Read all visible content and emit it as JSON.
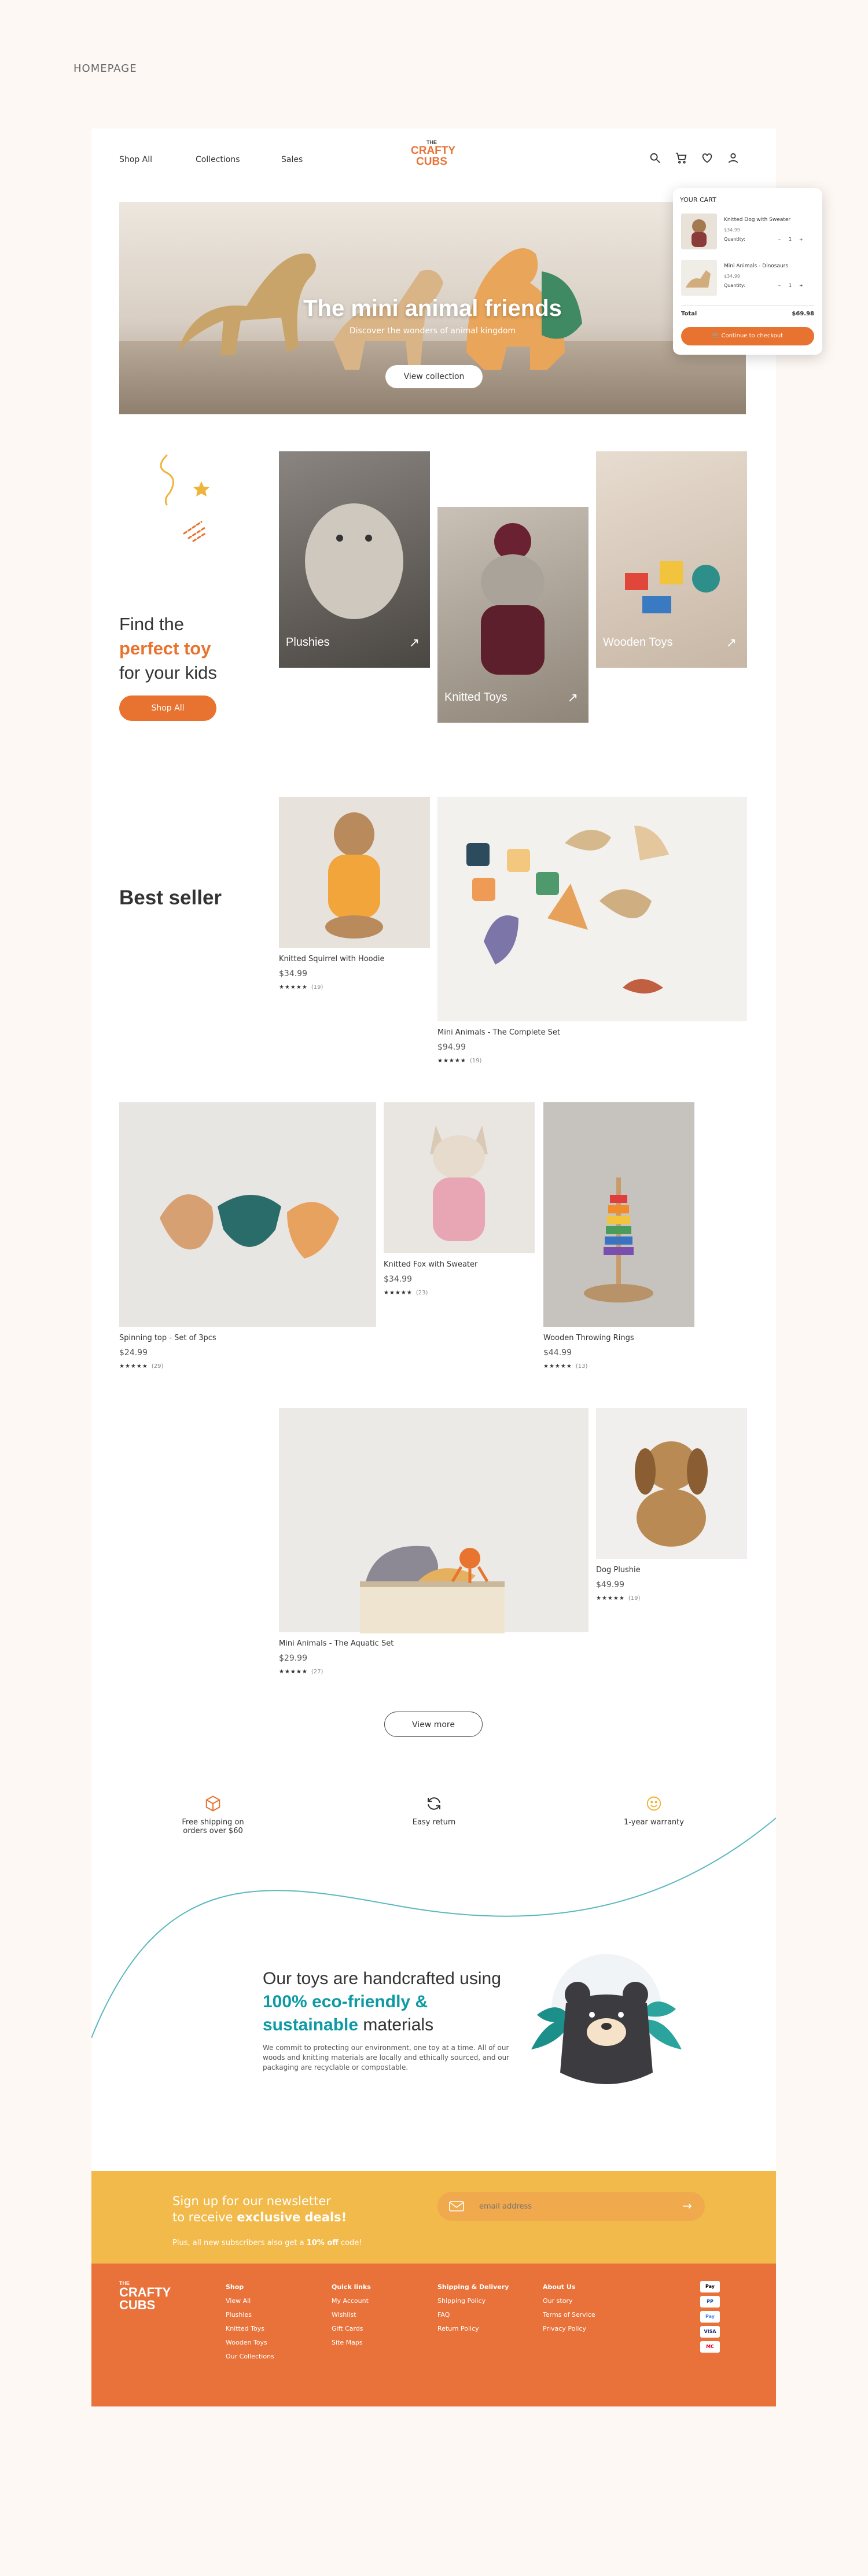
{
  "page_label": "HOMEPAGE",
  "brand": {
    "top": "THE",
    "line1": "CRAFTY",
    "line2": "CUBS"
  },
  "nav": {
    "links": [
      "Shop All",
      "Collections",
      "Sales"
    ]
  },
  "hero": {
    "title": "The mini animal friends",
    "subtitle": "Discover the wonders of animal kingdom",
    "button": "View collection"
  },
  "cart": {
    "title": "YOUR CART",
    "items": [
      {
        "name": "Knitted Dog with Sweater",
        "price": "$34.99",
        "qty_label": "Quantity:",
        "minus": "–",
        "qty": "1",
        "plus": "+"
      },
      {
        "name": "Mini Animals - Dinosaurs",
        "price": "$34.99",
        "qty_label": "Quantity:",
        "minus": "–",
        "qty": "1",
        "plus": "+"
      }
    ],
    "total_label": "Total",
    "total_value": "$69.98",
    "checkout": "Continue to checkout"
  },
  "intro": {
    "line1": "Find the",
    "highlight": "perfect toy",
    "line3": "for your kids",
    "button": "Shop All"
  },
  "categories": [
    "Plushies",
    "Knitted Toys",
    "Wooden Toys"
  ],
  "bestseller": {
    "title": "Best seller"
  },
  "products": [
    {
      "name": "Knitted Squirrel with Hoodie",
      "price": "$34.99",
      "stars": "★★★★★",
      "reviews": "(19)"
    },
    {
      "name": "Mini Animals - The Complete Set",
      "price": "$94.99",
      "stars": "★★★★★",
      "reviews": "(19)"
    },
    {
      "name": "Spinning top - Set of 3pcs",
      "price": "$24.99",
      "stars": "★★★★★",
      "reviews": "(29)"
    },
    {
      "name": "Knitted Fox with Sweater",
      "price": "$34.99",
      "stars": "★★★★★",
      "reviews": "(23)"
    },
    {
      "name": "Wooden Throwing Rings",
      "price": "$44.99",
      "stars": "★★★★★",
      "reviews": "(13)"
    },
    {
      "name": "Mini Animals - The Aquatic Set",
      "price": "$29.99",
      "stars": "★★★★★",
      "reviews": "(27)"
    },
    {
      "name": "Dog Plushie",
      "price": "$49.99",
      "stars": "★★★★★",
      "reviews": "(19)"
    }
  ],
  "view_more": "View more",
  "features": [
    {
      "line1": "Free shipping on",
      "line2": "orders over $60"
    },
    {
      "line1": "Easy return",
      "line2": ""
    },
    {
      "line1": "1-year warranty",
      "line2": ""
    }
  ],
  "eco": {
    "line1": "Our toys are handcrafted using",
    "highlight": "100% eco-friendly &",
    "highlight2": "sustainable",
    "line3": " materials",
    "text": "We commit to protecting our environment, one toy at a time. All of our woods and knitting materials are locally and ethically sourced, and our packaging are recyclable or compostable."
  },
  "newsletter": {
    "line1": "Sign up for our newsletter",
    "line2_pre": "to receive ",
    "line2_bold": "exclusive deals!",
    "sub_pre": "Plus, all new subscribers also get a ",
    "sub_bold": "10% off",
    "sub_post": " code!",
    "placeholder": "email address"
  },
  "footer": {
    "columns": [
      {
        "title": "Shop",
        "links": [
          "View All",
          "Plushies",
          "Knitted Toys",
          "Wooden Toys",
          "Our Collections"
        ]
      },
      {
        "title": "Quick links",
        "links": [
          "My Account",
          "Wishlist",
          "Gift Cards",
          "Site Maps"
        ]
      },
      {
        "title": "Shipping & Delivery",
        "links": [
          "Shipping Policy",
          "FAQ",
          "Return Policy"
        ]
      },
      {
        "title": "About Us",
        "links": [
          "Our story",
          "Terms of Service",
          "Privacy Policy"
        ]
      }
    ],
    "payments": [
      "Pay",
      "PP",
      "Pay",
      "VISA",
      "MC"
    ]
  },
  "colors": {
    "accent": "#e8722f",
    "teal": "#0e9aa4",
    "yellow": "#f2ba4a",
    "footer": "#e8723a"
  }
}
